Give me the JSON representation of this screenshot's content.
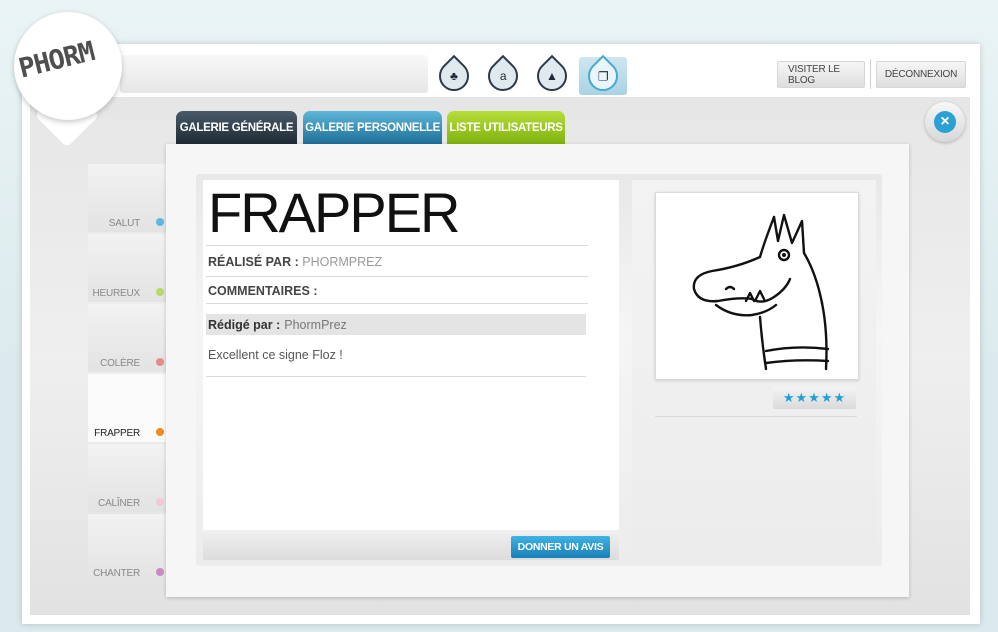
{
  "logo": {
    "text": "PHORM"
  },
  "header": {
    "nav_icons": [
      {
        "icon": "tree-icon",
        "glyph": "♣"
      },
      {
        "icon": "alphabet-icon",
        "glyph": "a"
      },
      {
        "icon": "pencil-icon",
        "glyph": "▲"
      },
      {
        "icon": "gallery-icon",
        "glyph": "❐"
      }
    ],
    "blog_label": "VISITER LE BLOG",
    "logout_label": "DÉCONNEXION"
  },
  "tabs": [
    {
      "label": "GALERIE GÉNÉRALE"
    },
    {
      "label": "GALERIE PERSONNELLE"
    },
    {
      "label": "LISTE UTILISATEURS"
    }
  ],
  "sidebar": {
    "items": [
      {
        "label": "SALUT",
        "color": "#5bb8e0"
      },
      {
        "label": "HEUREUX",
        "color": "#b8d86a"
      },
      {
        "label": "COLÈRE",
        "color": "#e88a8a"
      },
      {
        "label": "FRAPPER",
        "color": "#f08a1e"
      },
      {
        "label": "CALÎNER",
        "color": "#f2c9d6"
      },
      {
        "label": "CHANTER",
        "color": "#c98ac2"
      }
    ]
  },
  "sign": {
    "title": "FRAPPER",
    "author_label": "RÉALISÉ PAR :",
    "author": "PHORMPREZ",
    "comments_label": "COMMENTAIRES :"
  },
  "comment": {
    "written_by_label": "Rédigé par :",
    "author": "PhormPrez",
    "text": "Excellent ce signe Floz !"
  },
  "rating": {
    "stars": "★★★★★",
    "value": 5
  },
  "actions": {
    "give_opinion": "DONNER UN AVIS"
  },
  "colors": {
    "accent": "#1ea0d8",
    "tab_green": "#8dc21f",
    "tab_dark": "#2a3744"
  }
}
